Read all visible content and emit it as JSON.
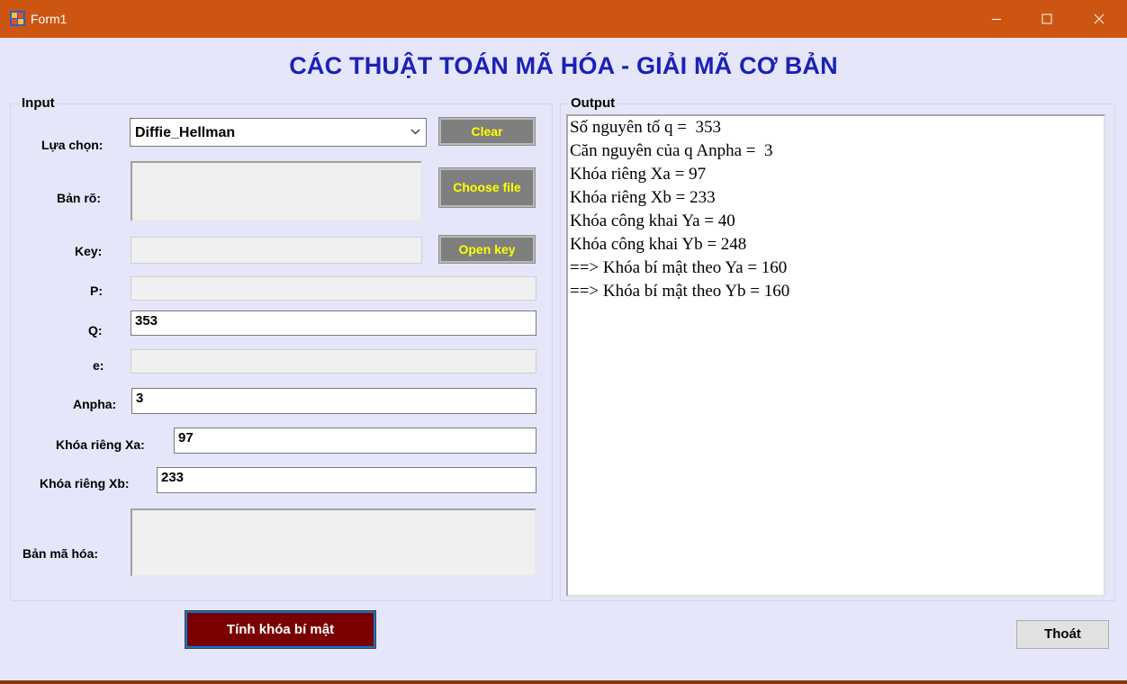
{
  "window": {
    "title": "Form1"
  },
  "heading": "CÁC THUẬT TOÁN MÃ HÓA - GIẢI MÃ CƠ BẢN",
  "input_group": {
    "legend": "Input",
    "algorithm": {
      "label": "Lựa chọn:",
      "selected": "Diffie_Hellman"
    },
    "plaintext": {
      "label": "Bản rõ:",
      "value": ""
    },
    "key": {
      "label": "Key:",
      "value": ""
    },
    "p": {
      "label": "P:",
      "value": ""
    },
    "q": {
      "label": "Q:",
      "value": "353"
    },
    "e": {
      "label": "e:",
      "value": ""
    },
    "alpha": {
      "label": "Anpha:",
      "value": "3"
    },
    "xa": {
      "label": "Khóa riêng Xa:",
      "value": "97"
    },
    "xb": {
      "label": "Khóa riêng Xb:",
      "value": "233"
    },
    "ciphertext": {
      "label": "Bản mã hóa:",
      "value": ""
    },
    "buttons": {
      "clear": "Clear",
      "choose_file": "Choose file",
      "open_key": "Open key"
    }
  },
  "output_group": {
    "legend": "Output",
    "lines": [
      "Số nguyên tố q =  353",
      "Căn nguyên của q Anpha =  3",
      "Khóa riêng Xa = 97",
      "Khóa riêng Xb = 233",
      "Khóa công khai Ya = 40",
      "Khóa công khai Yb = 248",
      "==> Khóa bí mật theo Ya = 160",
      "==> Khóa bí mật theo Yb = 160"
    ]
  },
  "actions": {
    "compute": "Tính khóa bí mật",
    "exit": "Thoát"
  },
  "colors": {
    "titlebar": "#cd5512",
    "background": "#e6e6fa",
    "heading": "#1a21b8",
    "compute_button": "#7a0000",
    "gray_button": "#7f7f7f",
    "gray_button_text": "#ffff00"
  }
}
